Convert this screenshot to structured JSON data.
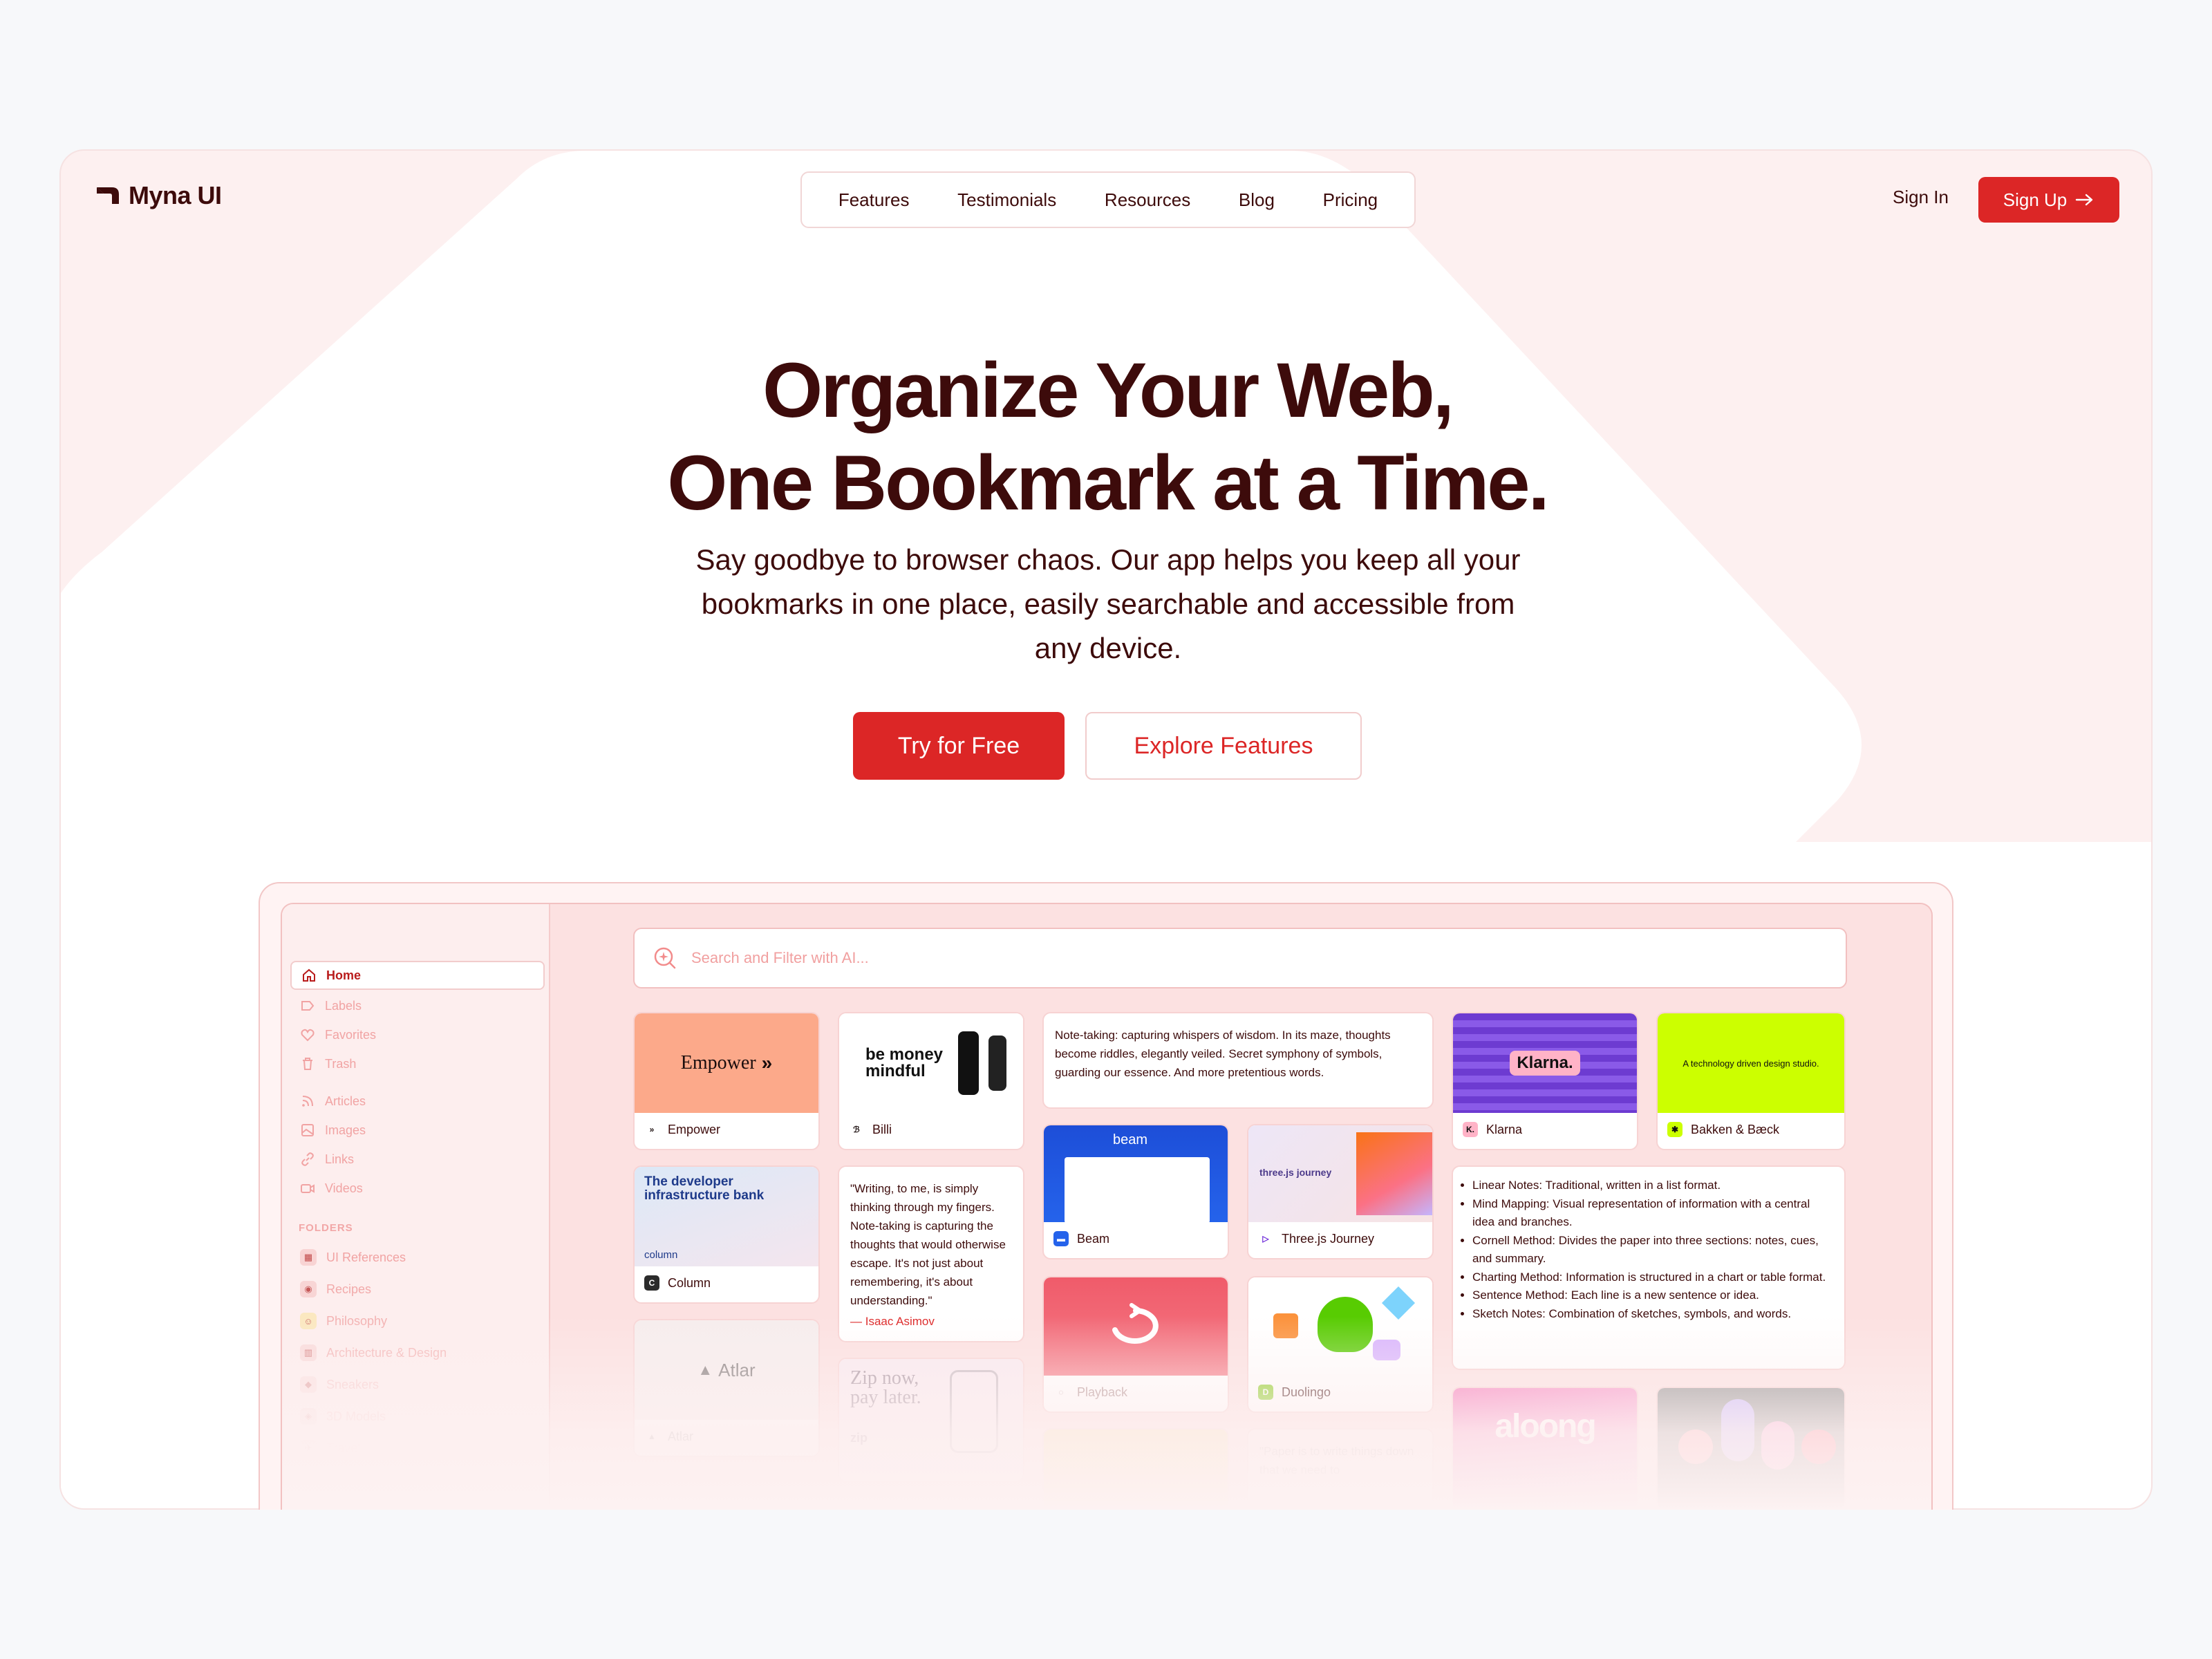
{
  "brand": {
    "name": "Myna UI"
  },
  "nav": {
    "items": [
      "Features",
      "Testimonials",
      "Resources",
      "Blog",
      "Pricing"
    ]
  },
  "auth": {
    "sign_in": "Sign In",
    "sign_up": "Sign Up"
  },
  "hero": {
    "title_line1": "Organize Your Web,",
    "title_line2": "One Bookmark at a Time.",
    "subtitle": "Say goodbye to browser chaos. Our app helps you keep all your bookmarks in one place, easily searchable and accessible from any device.",
    "primary_cta": "Try for Free",
    "secondary_cta": "Explore Features"
  },
  "colors": {
    "accent": "#dc2626",
    "text": "#3d0b0b",
    "background": "#f7f8fa",
    "frame": "#fdf0f0"
  },
  "app": {
    "search_placeholder": "Search and Filter with AI...",
    "sidebar": {
      "items": [
        "Home",
        "Labels",
        "Favorites",
        "Trash",
        "Articles",
        "Images",
        "Links",
        "Videos"
      ],
      "folders_label": "FOLDERS",
      "folders": [
        "UI References",
        "Recipes",
        "Philosophy",
        "Architecture & Design",
        "Sneakers",
        "3D Models",
        "Travel"
      ]
    },
    "cards": {
      "empower": {
        "thumb_text": "Empower",
        "caption": "Empower"
      },
      "billi": {
        "thumb_text": "be money mindful",
        "caption": "Billi"
      },
      "note1": "Note-taking: capturing whispers of wisdom. In its maze, thoughts become riddles, elegantly veiled. Secret symphony of symbols, guarding our essence. And more pretentious words.",
      "klarna": {
        "thumb_text": "Klarna.",
        "caption": "Klarna"
      },
      "bakken": {
        "thumb_text": "A technology driven design studio.",
        "caption": "Bakken & Bæck"
      },
      "column": {
        "thumb_text": "The developer infrastructure bank",
        "thumb_sub": "column",
        "caption": "Column"
      },
      "quote": {
        "text": "\"Writing, to me, is simply thinking through my fingers. Note-taking is capturing the thoughts that would otherwise escape. It's not just about remembering, it's about understanding.\"",
        "author": "— Isaac Asimov"
      },
      "beam": {
        "thumb_text": "beam",
        "caption": "Beam"
      },
      "threejs": {
        "thumb_text": "three.js journey",
        "caption": "Three.js Journey"
      },
      "notes_list": [
        "Linear Notes: Traditional, written in a list format.",
        "Mind Mapping: Visual representation of information with a central idea and branches.",
        "Cornell Method: Divides the paper into three sections: notes, cues, and summary.",
        "Charting Method: Information is structured in a chart or table format.",
        "Sentence Method: Each line is a new sentence or idea.",
        "Sketch Notes: Combination of sketches, symbols, and words."
      ],
      "atlar": {
        "thumb_text": "Atlar",
        "caption": "Atlar"
      },
      "zip": {
        "thumb_text": "Zip now, pay later.",
        "thumb_brand": "zip"
      },
      "playback": {
        "caption": "Playback"
      },
      "duolingo": {
        "caption": "Duolingo"
      },
      "aloong": {
        "thumb_text": "aloong"
      },
      "paper_quote": "\"Paper is to write things down that we need to"
    }
  }
}
